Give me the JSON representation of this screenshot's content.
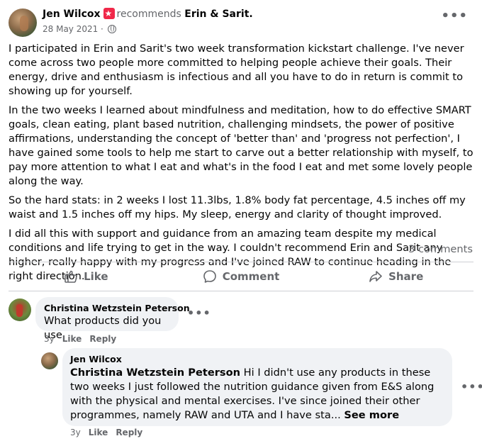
{
  "post": {
    "author": "Jen Wilcox",
    "verb": "recommends",
    "target": "Erin & Sarit.",
    "date": "28 May 2021 ·",
    "more_glyph": "•••",
    "paragraphs": [
      "I participated in Erin and Sarit's two week transformation kickstart challenge. I've never come across two people more committed to helping people achieve their goals. Their energy, drive and enthusiasm is infectious and all you have to do in return is commit to showing up for yourself.",
      "In the two weeks I learned about mindfulness and meditation, how to do effective SMART goals, clean eating, plant based nutrition, challenging mindsets, the power of positive affirmations, understanding the concept of 'better than' and 'progress not perfection', I have gained some tools to help me start to carve out a better relationship with myself, to pay more attention to what I eat and what's in the food I eat and met some lovely people along the way.",
      "So the hard stats: in 2 weeks I lost 11.3lbs, 1.8% body fat percentage, 4.5 inches off my waist and 1.5 inches off my hips. My sleep, energy and clarity of thought improved.",
      "I did all this with support and guidance from an amazing team despite my medical conditions and life trying to get in the way. I couldn't recommend Erin and Sarit any higher, really happy with my progress and I've joined RAW to continue heading in the right direction."
    ],
    "comments_count": "3 comments"
  },
  "actions": {
    "like": "Like",
    "comment": "Comment",
    "share": "Share"
  },
  "comments": [
    {
      "author": "Christina Wetzstein Peterson",
      "text": "What products did you use",
      "age": "3y",
      "like": "Like",
      "reply": "Reply"
    },
    {
      "author": "Jen Wilcox",
      "mention": "Christina Wetzstein Peterson",
      "text": " Hi I didn't use any products in these two weeks I just followed the nutrition guidance given from E&S along with the physical and mental exercises. I've since joined their other programmes, namely RAW and UTA and I have sta... ",
      "see_more": "See more",
      "age": "3y",
      "like": "Like",
      "reply": "Reply"
    }
  ],
  "colors": {
    "secondary_text": "#65676b",
    "bubble_bg": "#f0f2f5",
    "badge": "#f02849",
    "divider": "#ced0d4"
  }
}
